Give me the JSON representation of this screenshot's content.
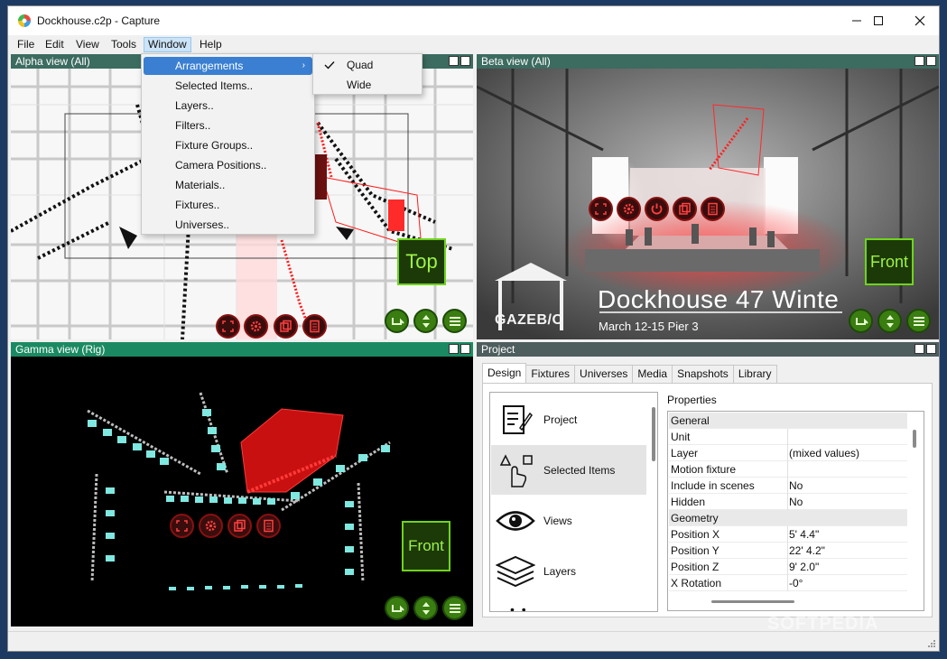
{
  "titlebar": {
    "title": "Dockhouse.c2p - Capture"
  },
  "menubar": {
    "items": [
      "File",
      "Edit",
      "View",
      "Tools",
      "Window",
      "Help"
    ]
  },
  "window_menu": {
    "items": [
      "Arrangements",
      "Selected Items..",
      "Layers..",
      "Filters..",
      "Fixture Groups..",
      "Camera Positions..",
      "Materials..",
      "Fixtures..",
      "Universes.."
    ],
    "highlighted": "Arrangements",
    "submenu": {
      "items": [
        "Quad",
        "Wide"
      ],
      "checked": "Quad"
    }
  },
  "views": {
    "alpha": {
      "title": "Alpha view  (All)",
      "label": "Top"
    },
    "beta": {
      "title": "Beta view  (All)",
      "label": "Front",
      "headline": "Dockhouse 47 Winte",
      "subline": "March 12-15 Pier 3",
      "brand": "GAZEB/O"
    },
    "gamma": {
      "title": "Gamma view  (Rig)",
      "label": "Front"
    }
  },
  "project": {
    "title": "Project",
    "tabs": [
      "Design",
      "Fixtures",
      "Universes",
      "Media",
      "Snapshots",
      "Library"
    ],
    "active_tab": "Design",
    "design_items": [
      "Project",
      "Selected Items",
      "Views",
      "Layers"
    ],
    "selected_design_item": "Selected Items",
    "properties_title": "Properties",
    "properties": [
      {
        "name": "General",
        "value": "",
        "group": true
      },
      {
        "name": "Unit",
        "value": ""
      },
      {
        "name": "Layer",
        "value": "(mixed values)"
      },
      {
        "name": "Motion fixture",
        "value": ""
      },
      {
        "name": "Include in scenes",
        "value": "No"
      },
      {
        "name": "Hidden",
        "value": "No"
      },
      {
        "name": "Geometry",
        "value": "",
        "group": true
      },
      {
        "name": "Position X",
        "value": "5' 4.4\""
      },
      {
        "name": "Position Y",
        "value": "22' 4.2\""
      },
      {
        "name": "Position Z",
        "value": "9' 2.0\""
      },
      {
        "name": "X Rotation",
        "value": "-0°"
      }
    ]
  },
  "watermark": "SOFTPEDIA",
  "colors": {
    "accent": "#3a7fd2",
    "fixture_red": "#ff2020",
    "view_label_green": "#6fd41c",
    "rig_cyan": "#7fe8e0"
  }
}
